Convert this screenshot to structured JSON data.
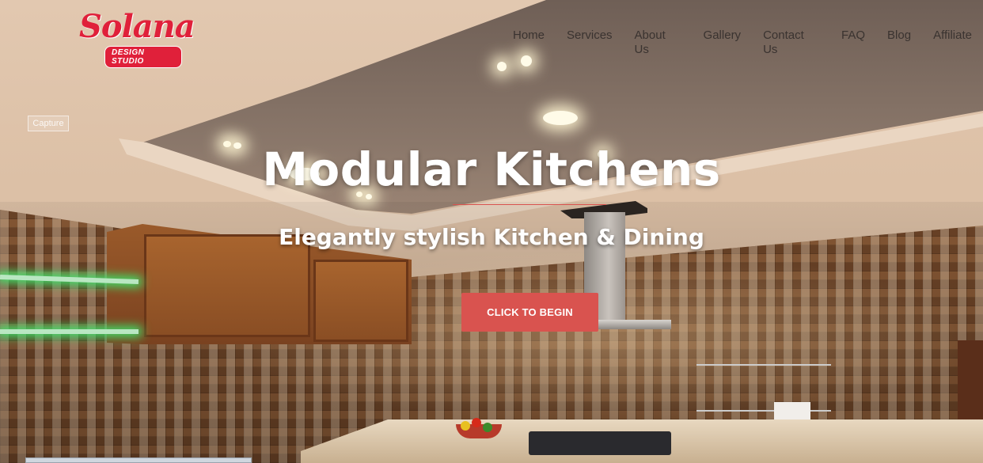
{
  "brand": {
    "name": "Solana",
    "tagline": "DESIGN STUDIO",
    "color": "#e0203a"
  },
  "nav": {
    "items": [
      {
        "label": "Home"
      },
      {
        "label": "Services"
      },
      {
        "label": "About Us"
      },
      {
        "label": "Gallery"
      },
      {
        "label": "Contact Us"
      },
      {
        "label": "FAQ"
      },
      {
        "label": "Blog"
      },
      {
        "label": "Affiliate"
      }
    ]
  },
  "capture_label": "Capture",
  "hero": {
    "title": "Modular Kitchens",
    "subtitle": "Elegantly stylish Kitchen & Dining",
    "cta_label": "CLICK TO BEGIN",
    "accent_color": "#d9534f"
  }
}
